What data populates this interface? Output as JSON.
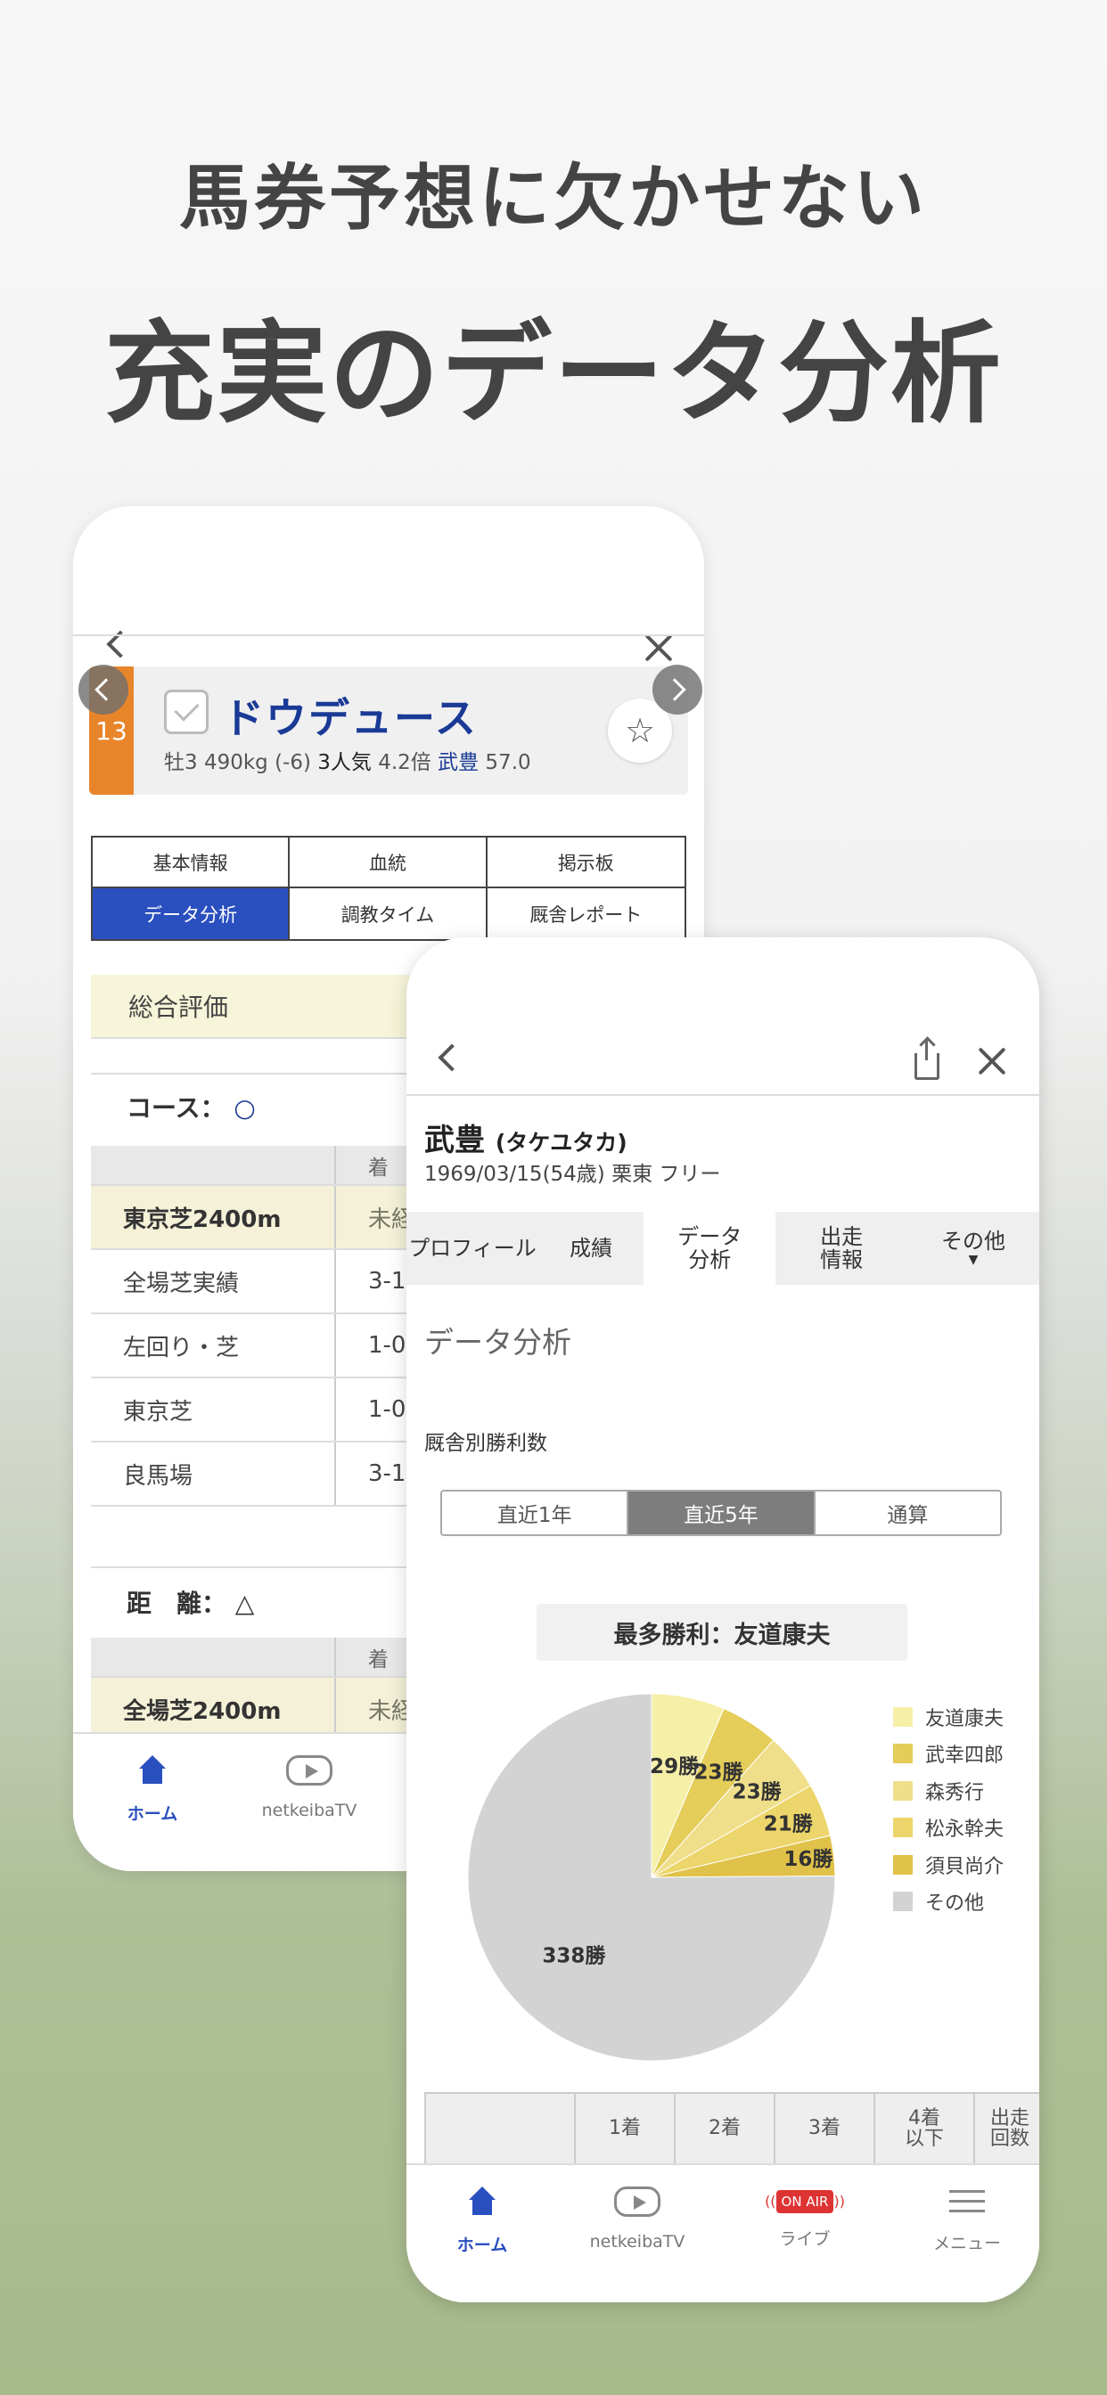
{
  "headline": {
    "line1": "馬券予想に欠かせない",
    "line2": "充実のデータ分析"
  },
  "horse_screen": {
    "horse": {
      "number": "13",
      "name": "ドウデュース",
      "info_prefix": "牡3 490kg (-6)",
      "popularity": "3人気",
      "odds": "4.2倍",
      "jockey": "武豊",
      "weight": "57.0"
    },
    "tabs": [
      {
        "label": "基本情報",
        "active": false
      },
      {
        "label": "血統",
        "active": false
      },
      {
        "label": "掲示板",
        "active": false
      },
      {
        "label": "データ分析",
        "active": true
      },
      {
        "label": "調教タイム",
        "active": false
      },
      {
        "label": "厩舎レポート",
        "active": false
      }
    ],
    "section_title": "総合評価",
    "course": {
      "label": "コース：",
      "mark": "○",
      "header": "着",
      "rows": [
        {
          "name": "東京芝2400m",
          "value": "未経",
          "highlight": true
        },
        {
          "name": "全場芝実績",
          "value": "3-1-",
          "highlight": false
        },
        {
          "name": "左回り・芝",
          "value": "1-0-",
          "highlight": false
        },
        {
          "name": "東京芝",
          "value": "1-0-",
          "highlight": false
        },
        {
          "name": "良馬場",
          "value": "3-1-",
          "highlight": false
        }
      ]
    },
    "distance": {
      "label": "距　離：",
      "mark": "△",
      "header": "着",
      "rows": [
        {
          "name": "全場芝2400m",
          "value": "未経",
          "highlight": true
        }
      ]
    },
    "nav": [
      {
        "label": "ホーム",
        "icon": "home-icon",
        "active": true
      },
      {
        "label": "netkeibaTV",
        "icon": "tv-icon",
        "active": false
      }
    ]
  },
  "jockey_screen": {
    "name": "武豊",
    "kana": "(タケユタカ)",
    "meta": "1969/03/15(54歳) 栗東 フリー",
    "tabs": [
      {
        "label": "プロフィール",
        "active": false
      },
      {
        "label": "成績",
        "active": false
      },
      {
        "label": "データ\n分析",
        "active": true
      },
      {
        "label": "出走\n情報",
        "active": false
      },
      {
        "label": "その他",
        "active": false,
        "dropdown": "▼"
      }
    ],
    "section_title": "データ分析",
    "subheading": "厩舎別勝利数",
    "period_tabs": [
      {
        "label": "直近1年",
        "active": false
      },
      {
        "label": "直近5年",
        "active": true
      },
      {
        "label": "通算",
        "active": false
      }
    ],
    "top_winner": "最多勝利：友道康夫",
    "table_headers": [
      "",
      "1着",
      "2着",
      "3着",
      "4着\n以下",
      "出走\n回数"
    ],
    "nav": [
      {
        "label": "ホーム",
        "icon": "home-icon",
        "active": true
      },
      {
        "label": "netkeibaTV",
        "icon": "tv-icon",
        "active": false
      },
      {
        "label": "ライブ",
        "icon": "onair-icon",
        "badge": "ON AIR",
        "active": false
      },
      {
        "label": "メニュー",
        "icon": "menu-icon",
        "active": false
      }
    ]
  },
  "chart_data": {
    "type": "pie",
    "title": "最多勝利：友道康夫",
    "unit": "勝",
    "slices": [
      {
        "name": "友道康夫",
        "value": 29,
        "color": "#f6efa8"
      },
      {
        "name": "武幸四郎",
        "value": 23,
        "color": "#e4cd58"
      },
      {
        "name": "森秀行",
        "value": 23,
        "color": "#f0df8a"
      },
      {
        "name": "松永幹夫",
        "value": 21,
        "color": "#ecd56a"
      },
      {
        "name": "須貝尚介",
        "value": 16,
        "color": "#e0c24a"
      },
      {
        "name": "その他",
        "value": 338,
        "color": "#d3d3d3"
      }
    ],
    "legend_position": "right"
  },
  "colors": {
    "accent_blue": "#2a4fbf",
    "horse_number_bg": "#e8852b",
    "onair_red": "#d33333"
  }
}
